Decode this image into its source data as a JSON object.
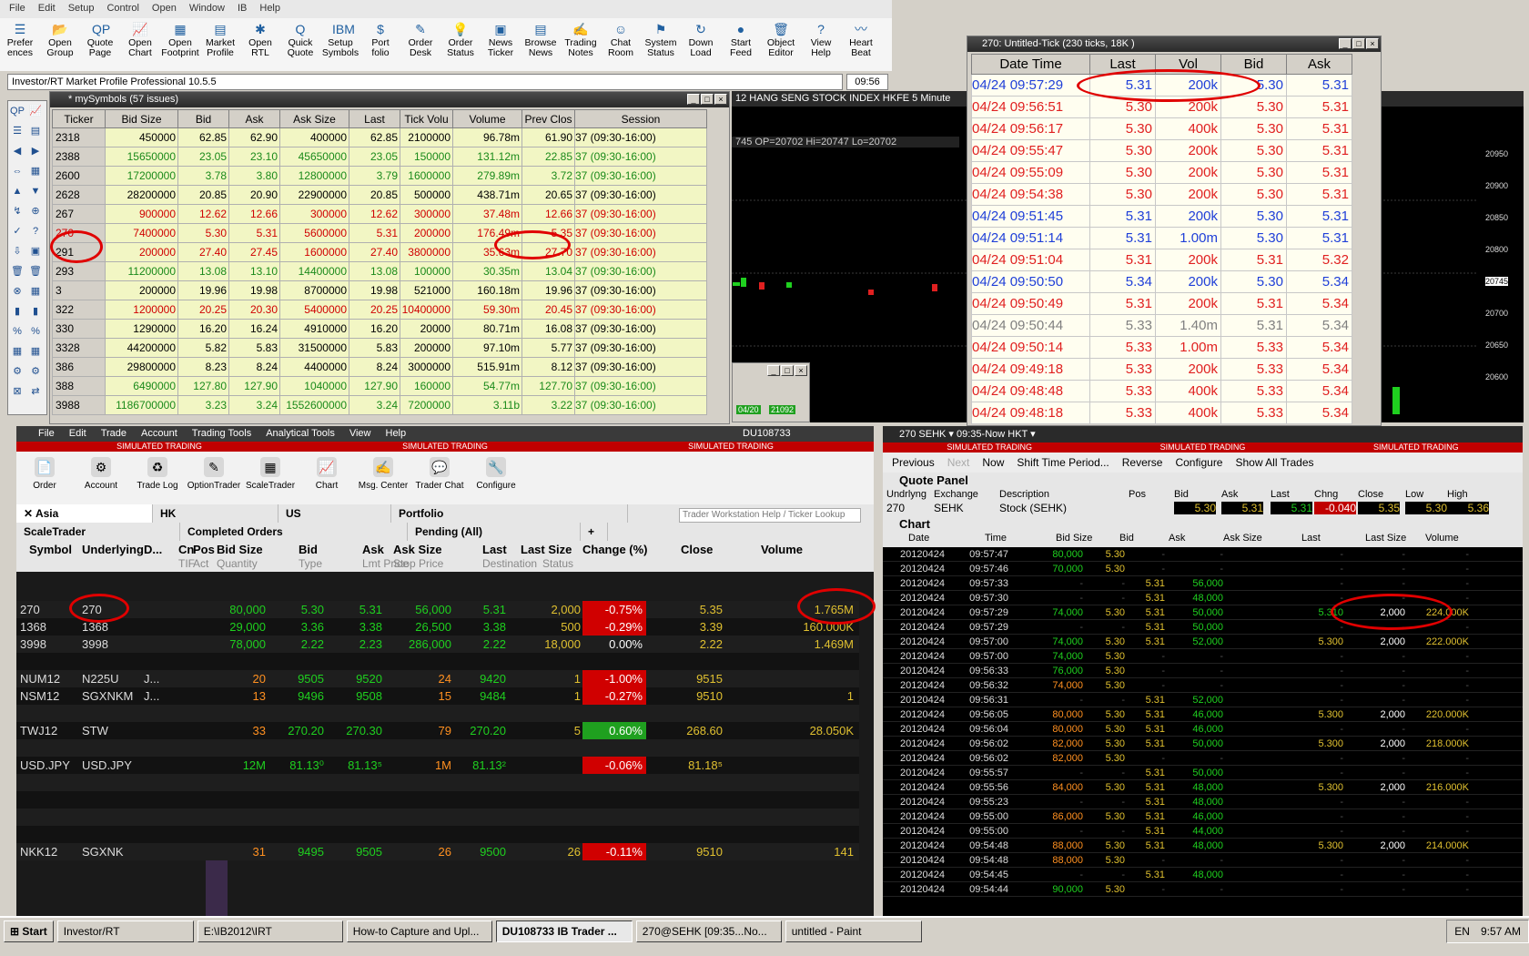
{
  "menubar": [
    "File",
    "Edit",
    "Setup",
    "Control",
    "Open",
    "Window",
    "IB",
    "Help"
  ],
  "toolbar": [
    {
      "l1": "Prefer",
      "l2": "ences",
      "icon": "☰"
    },
    {
      "l1": "Open",
      "l2": "Group",
      "icon": "📂"
    },
    {
      "l1": "Quote",
      "l2": "Page",
      "icon": "QP"
    },
    {
      "l1": "Open",
      "l2": "Chart",
      "icon": "📈"
    },
    {
      "l1": "Open",
      "l2": "Footprint",
      "icon": "▦"
    },
    {
      "l1": "Market",
      "l2": "Profile",
      "icon": "▤"
    },
    {
      "l1": "Open",
      "l2": "RTL",
      "icon": "✱"
    },
    {
      "l1": "Quick",
      "l2": "Quote",
      "icon": "Q"
    },
    {
      "l1": "Setup",
      "l2": "Symbols",
      "icon": "IBM"
    },
    {
      "l1": "Port",
      "l2": "folio",
      "icon": "$"
    },
    {
      "l1": "Order",
      "l2": "Desk",
      "icon": "✎"
    },
    {
      "l1": "Order",
      "l2": "Status",
      "icon": "💡"
    },
    {
      "l1": "News",
      "l2": "Ticker",
      "icon": "▣"
    },
    {
      "l1": "Browse",
      "l2": "News",
      "icon": "▤"
    },
    {
      "l1": "Trading",
      "l2": "Notes",
      "icon": "✍"
    },
    {
      "l1": "Chat",
      "l2": "Room",
      "icon": "☺"
    },
    {
      "l1": "System",
      "l2": "Status",
      "icon": "⚑"
    },
    {
      "l1": "Down",
      "l2": "Load",
      "icon": "↻"
    },
    {
      "l1": "Start",
      "l2": "Feed",
      "icon": "●"
    },
    {
      "l1": "Object",
      "l2": "Editor",
      "icon": "🗑"
    },
    {
      "l1": "View",
      "l2": "Help",
      "icon": "?"
    },
    {
      "l1": "Heart",
      "l2": "Beat",
      "icon": "〰"
    }
  ],
  "address": "Investor/RT Market Profile Professional 10.5.5",
  "clock": "09:56",
  "mysymbols": {
    "title": "* mySymbols (57 issues)",
    "headers": [
      "Ticker",
      "Bid Size",
      "Bid",
      "Ask",
      "Ask Size",
      "Last",
      "Tick Volu",
      "Volume",
      "Prev Clos",
      "Session"
    ],
    "rows": [
      [
        "2318",
        "450000",
        "62.85",
        "62.90",
        "400000",
        "62.85",
        "2100000",
        "96.78m",
        "61.90",
        "37 (09:30-16:00)"
      ],
      [
        "2388",
        "15650000",
        "23.05",
        "23.10",
        "45650000",
        "23.05",
        "150000",
        "131.12m",
        "22.85",
        "37 (09:30-16:00)"
      ],
      [
        "2600",
        "17200000",
        "3.78",
        "3.80",
        "12800000",
        "3.79",
        "1600000",
        "279.89m",
        "3.72",
        "37 (09:30-16:00)"
      ],
      [
        "2628",
        "28200000",
        "20.85",
        "20.90",
        "22900000",
        "20.85",
        "500000",
        "438.71m",
        "20.65",
        "37 (09:30-16:00)"
      ],
      [
        "267",
        "900000",
        "12.62",
        "12.66",
        "300000",
        "12.62",
        "300000",
        "37.48m",
        "12.66",
        "37 (09:30-16:00)"
      ],
      [
        "270",
        "7400000",
        "5.30",
        "5.31",
        "5600000",
        "5.31",
        "200000",
        "176.49m",
        "5.35",
        "37 (09:30-16:00)"
      ],
      [
        "291",
        "200000",
        "27.40",
        "27.45",
        "1600000",
        "27.40",
        "3800000",
        "35.63m",
        "27.70",
        "37 (09:30-16:00)"
      ],
      [
        "293",
        "11200000",
        "13.08",
        "13.10",
        "14400000",
        "13.08",
        "100000",
        "30.35m",
        "13.04",
        "37 (09:30-16:00)"
      ],
      [
        "3",
        "200000",
        "19.96",
        "19.98",
        "8700000",
        "19.98",
        "521000",
        "160.18m",
        "19.96",
        "37 (09:30-16:00)"
      ],
      [
        "322",
        "1200000",
        "20.25",
        "20.30",
        "5400000",
        "20.25",
        "10400000",
        "59.30m",
        "20.45",
        "37 (09:30-16:00)"
      ],
      [
        "330",
        "1290000",
        "16.20",
        "16.24",
        "4910000",
        "16.20",
        "20000",
        "80.71m",
        "16.08",
        "37 (09:30-16:00)"
      ],
      [
        "3328",
        "44200000",
        "5.82",
        "5.83",
        "31500000",
        "5.83",
        "200000",
        "97.10m",
        "5.77",
        "37 (09:30-16:00)"
      ],
      [
        "386",
        "29800000",
        "8.23",
        "8.24",
        "4400000",
        "8.24",
        "3000000",
        "515.91m",
        "8.12",
        "37 (09:30-16:00)"
      ],
      [
        "388",
        "6490000",
        "127.80",
        "127.90",
        "1040000",
        "127.90",
        "160000",
        "54.77m",
        "127.70",
        "37 (09:30-16:00)"
      ],
      [
        "3988",
        "1186700000",
        "3.23",
        "3.24",
        "1552600000",
        "3.24",
        "7200000",
        "3.11b",
        "3.22",
        "37 (09:30-16:00)"
      ]
    ]
  },
  "hangseng": {
    "title": "12 HANG SENG STOCK INDEX HKFE 5 Minute",
    "ohlc": "745 OP=20702 Hi=20747 Lo=20702",
    "price_labels": [
      "20950",
      "20900",
      "20850",
      "20800",
      "20745",
      "20700",
      "20650",
      "20600"
    ],
    "mini_date": "04/20",
    "mini_price": "21092"
  },
  "tick": {
    "title": "270: Untitled-Tick (230 ticks, 18K )",
    "headers": [
      "Date Time",
      "Last",
      "Vol",
      "Bid",
      "Ask"
    ],
    "rows": [
      {
        "c": [
          "04/24 09:57:29",
          "5.31",
          "200k",
          "5.30",
          "5.31"
        ],
        "col": "#1f3fd8"
      },
      {
        "c": [
          "04/24 09:56:51",
          "5.30",
          "200k",
          "5.30",
          "5.31"
        ],
        "col": "#e02020"
      },
      {
        "c": [
          "04/24 09:56:17",
          "5.30",
          "400k",
          "5.30",
          "5.31"
        ],
        "col": "#e02020"
      },
      {
        "c": [
          "04/24 09:55:47",
          "5.30",
          "200k",
          "5.30",
          "5.31"
        ],
        "col": "#e02020"
      },
      {
        "c": [
          "04/24 09:55:09",
          "5.30",
          "200k",
          "5.30",
          "5.31"
        ],
        "col": "#e02020"
      },
      {
        "c": [
          "04/24 09:54:38",
          "5.30",
          "200k",
          "5.30",
          "5.31"
        ],
        "col": "#e02020"
      },
      {
        "c": [
          "04/24 09:51:45",
          "5.31",
          "200k",
          "5.30",
          "5.31"
        ],
        "col": "#1f3fd8"
      },
      {
        "c": [
          "04/24 09:51:14",
          "5.31",
          "1.00m",
          "5.30",
          "5.31"
        ],
        "col": "#1f3fd8"
      },
      {
        "c": [
          "04/24 09:51:04",
          "5.31",
          "200k",
          "5.31",
          "5.32"
        ],
        "col": "#e02020"
      },
      {
        "c": [
          "04/24 09:50:50",
          "5.34",
          "200k",
          "5.30",
          "5.34"
        ],
        "col": "#1f3fd8"
      },
      {
        "c": [
          "04/24 09:50:49",
          "5.31",
          "200k",
          "5.31",
          "5.34"
        ],
        "col": "#e02020"
      },
      {
        "c": [
          "04/24 09:50:44",
          "5.33",
          "1.40m",
          "5.31",
          "5.34"
        ],
        "col": "#808080"
      },
      {
        "c": [
          "04/24 09:50:14",
          "5.33",
          "1.00m",
          "5.33",
          "5.34"
        ],
        "col": "#e02020"
      },
      {
        "c": [
          "04/24 09:49:18",
          "5.33",
          "200k",
          "5.33",
          "5.34"
        ],
        "col": "#e02020"
      },
      {
        "c": [
          "04/24 09:48:48",
          "5.33",
          "400k",
          "5.33",
          "5.34"
        ],
        "col": "#e02020"
      },
      {
        "c": [
          "04/24 09:48:18",
          "5.33",
          "400k",
          "5.33",
          "5.34"
        ],
        "col": "#e02020"
      }
    ]
  },
  "tws": {
    "account": "DU108733",
    "menu": [
      "File",
      "Edit",
      "Trade",
      "Account",
      "Trading Tools",
      "Analytical Tools",
      "View",
      "Help"
    ],
    "sim": "SIMULATED TRADING",
    "tools": [
      "Order",
      "Account",
      "Trade Log",
      "OptionTrader",
      "ScaleTrader",
      "Chart",
      "Msg. Center",
      "Trader Chat",
      "Configure"
    ],
    "tabs": [
      "Asia",
      "HK",
      "US",
      "Portfolio"
    ],
    "search_placeholder": "Trader Workstation Help / Ticker Lookup",
    "subtabs": [
      "ScaleTrader",
      "Completed Orders",
      "Pending (All)",
      "+"
    ],
    "headers": {
      "symbol": "Symbol",
      "underlying": "Underlying",
      "d": "D...",
      "cn": "Cn",
      "pos": "Pos",
      "bidsize": "Bid Size",
      "bid": "Bid",
      "ask": "Ask",
      "asksize": "Ask Size",
      "last": "Last",
      "lastsize": "Last Size",
      "change": "Change (%)",
      "close": "Close",
      "volume": "Volume"
    },
    "subheaders": {
      "tif": "TIF",
      "act": "Act",
      "qty": "Quantity",
      "type": "Type",
      "lmt": "Lmt Price",
      "stop": "Stop Price",
      "dest": "Destination",
      "status": "Status"
    },
    "rows": [
      {
        "sym": "270",
        "und": "270",
        "bs": "80,000",
        "bid": "5.30",
        "ask": "5.31",
        "as": "56,000",
        "last": "5.31",
        "ls": "2,000",
        "chg": "-0.75%",
        "chgc": "#d00000",
        "close": "5.35",
        "vol": "1.765M"
      },
      {
        "sym": "1368",
        "und": "1368",
        "bs": "29,000",
        "bid": "3.36",
        "ask": "3.38",
        "as": "26,500",
        "last": "3.38",
        "ls": "500",
        "chg": "-0.29%",
        "chgc": "#d00000",
        "close": "3.39",
        "vol": "160.000K"
      },
      {
        "sym": "3998",
        "und": "3998",
        "bs": "78,000",
        "bid": "2.22",
        "ask": "2.23",
        "as": "286,000",
        "last": "2.22",
        "ls": "18,000",
        "chg": "0.00%",
        "chgc": "",
        "close": "2.22",
        "vol": "1.469M"
      },
      {
        "sym": "",
        "und": "",
        "bs": "",
        "bid": "",
        "ask": "",
        "as": "",
        "last": "",
        "ls": "",
        "chg": "",
        "chgc": "",
        "close": "",
        "vol": ""
      },
      {
        "sym": "NUM12",
        "und": "N225U",
        "d": "J...",
        "bs": "20",
        "bid": "9505",
        "ask": "9520",
        "as": "24",
        "last": "9420",
        "ls": "1",
        "chg": "-1.00%",
        "chgc": "#d00000",
        "close": "9515",
        "vol": ""
      },
      {
        "sym": "NSM12",
        "und": "SGXNKM",
        "d": "J...",
        "bs": "13",
        "bid": "9496",
        "ask": "9508",
        "as": "15",
        "last": "9484",
        "ls": "1",
        "chg": "-0.27%",
        "chgc": "#d00000",
        "close": "9510",
        "vol": "1"
      },
      {
        "sym": "",
        "und": "",
        "bs": "",
        "bid": "",
        "ask": "",
        "as": "",
        "last": "",
        "ls": "",
        "chg": "",
        "chgc": "",
        "close": "",
        "vol": ""
      },
      {
        "sym": "TWJ12",
        "und": "STW",
        "bs": "33",
        "bid": "270.20",
        "ask": "270.30",
        "as": "79",
        "last": "270.20",
        "ls": "5",
        "chg": "0.60%",
        "chgc": "#1fa01f",
        "close": "268.60",
        "vol": "28.050K"
      },
      {
        "sym": "",
        "und": "",
        "bs": "",
        "bid": "",
        "ask": "",
        "as": "",
        "last": "",
        "ls": "",
        "chg": "",
        "chgc": "",
        "close": "",
        "vol": ""
      },
      {
        "sym": "USD.JPY",
        "und": "USD.JPY",
        "bs": "12M",
        "bid": "81.13⁰",
        "ask": "81.13⁵",
        "as": "1M",
        "last": "81.13²",
        "ls": "",
        "chg": "-0.06%",
        "chgc": "#d00000",
        "close": "81.18⁵",
        "vol": ""
      },
      {
        "sym": "",
        "und": "",
        "bs": "",
        "bid": "",
        "ask": "",
        "as": "",
        "last": "",
        "ls": "",
        "chg": "",
        "chgc": "",
        "close": "",
        "vol": ""
      },
      {
        "sym": "",
        "und": "",
        "bs": "",
        "bid": "",
        "ask": "",
        "as": "",
        "last": "",
        "ls": "",
        "chg": "",
        "chgc": "",
        "close": "",
        "vol": ""
      },
      {
        "sym": "",
        "und": "",
        "bs": "",
        "bid": "",
        "ask": "",
        "as": "",
        "last": "",
        "ls": "",
        "chg": "",
        "chgc": "",
        "close": "",
        "vol": ""
      },
      {
        "sym": "",
        "und": "",
        "bs": "",
        "bid": "",
        "ask": "",
        "as": "",
        "last": "",
        "ls": "",
        "chg": "",
        "chgc": "",
        "close": "",
        "vol": ""
      },
      {
        "sym": "NKK12",
        "und": "SGXNK",
        "bs": "31",
        "bid": "9495",
        "ask": "9505",
        "as": "26",
        "last": "9500",
        "ls": "26",
        "chg": "-0.11%",
        "chgc": "#d00000",
        "close": "9510",
        "vol": "141"
      }
    ]
  },
  "sehk": {
    "title": "270 SEHK ▾   09:35-Now HKT ▾",
    "sim": "SIMULATED TRADING",
    "nav": [
      "Previous",
      "Next",
      "Now",
      "Shift Time Period...",
      "Reverse",
      "Configure",
      "Show All Trades"
    ],
    "quote_panel": "Quote Panel",
    "qheaders": [
      "Undrlyng",
      "Exchange",
      "Description",
      "Pos",
      "Bid",
      "Ask",
      "Last",
      "Chng",
      "Close",
      "Low",
      "High"
    ],
    "qrow": [
      "270",
      "SEHK",
      "Stock (SEHK)",
      "",
      "5.30",
      "5.31",
      "5.31",
      "-0.040",
      "5.35",
      "5.30",
      "5.36"
    ],
    "chart_label": "Chart",
    "theaders": [
      "Date",
      "Time",
      "Bid Size",
      "Bid",
      "Ask",
      "Ask Size",
      "Last",
      "Last Size",
      "Volume"
    ],
    "rows": [
      [
        "20120424",
        "09:57:47",
        "80,000",
        "5.30",
        "-",
        "-",
        "-",
        "-",
        "-"
      ],
      [
        "20120424",
        "09:57:46",
        "70,000",
        "5.30",
        "-",
        "-",
        "-",
        "-",
        "-"
      ],
      [
        "20120424",
        "09:57:33",
        "-",
        "-",
        "5.31",
        "56,000",
        "-",
        "-",
        "-"
      ],
      [
        "20120424",
        "09:57:30",
        "-",
        "-",
        "5.31",
        "48,000",
        "-",
        "-",
        "-"
      ],
      [
        "20120424",
        "09:57:29",
        "74,000",
        "5.30",
        "5.31",
        "50,000",
        "5.310",
        "2,000",
        "224.000K"
      ],
      [
        "20120424",
        "09:57:29",
        "-",
        "-",
        "5.31",
        "50,000",
        "-",
        "-",
        "-"
      ],
      [
        "20120424",
        "09:57:00",
        "74,000",
        "5.30",
        "5.31",
        "52,000",
        "5.300",
        "2,000",
        "222.000K"
      ],
      [
        "20120424",
        "09:57:00",
        "74,000",
        "5.30",
        "-",
        "-",
        "-",
        "-",
        "-"
      ],
      [
        "20120424",
        "09:56:33",
        "76,000",
        "5.30",
        "-",
        "-",
        "-",
        "-",
        "-"
      ],
      [
        "20120424",
        "09:56:32",
        "74,000",
        "5.30",
        "-",
        "-",
        "-",
        "-",
        "-"
      ],
      [
        "20120424",
        "09:56:31",
        "-",
        "-",
        "5.31",
        "52,000",
        "-",
        "-",
        "-"
      ],
      [
        "20120424",
        "09:56:05",
        "80,000",
        "5.30",
        "5.31",
        "46,000",
        "5.300",
        "2,000",
        "220.000K"
      ],
      [
        "20120424",
        "09:56:04",
        "80,000",
        "5.30",
        "5.31",
        "46,000",
        "-",
        "-",
        "-"
      ],
      [
        "20120424",
        "09:56:02",
        "82,000",
        "5.30",
        "5.31",
        "50,000",
        "5.300",
        "2,000",
        "218.000K"
      ],
      [
        "20120424",
        "09:56:02",
        "82,000",
        "5.30",
        "-",
        "-",
        "-",
        "-",
        "-"
      ],
      [
        "20120424",
        "09:55:57",
        "-",
        "-",
        "5.31",
        "50,000",
        "-",
        "-",
        "-"
      ],
      [
        "20120424",
        "09:55:56",
        "84,000",
        "5.30",
        "5.31",
        "48,000",
        "5.300",
        "2,000",
        "216.000K"
      ],
      [
        "20120424",
        "09:55:23",
        "-",
        "-",
        "5.31",
        "48,000",
        "-",
        "-",
        "-"
      ],
      [
        "20120424",
        "09:55:00",
        "86,000",
        "5.30",
        "5.31",
        "46,000",
        "-",
        "-",
        "-"
      ],
      [
        "20120424",
        "09:55:00",
        "-",
        "-",
        "5.31",
        "44,000",
        "-",
        "-",
        "-"
      ],
      [
        "20120424",
        "09:54:48",
        "88,000",
        "5.30",
        "5.31",
        "48,000",
        "5.300",
        "2,000",
        "214.000K"
      ],
      [
        "20120424",
        "09:54:48",
        "88,000",
        "5.30",
        "-",
        "-",
        "-",
        "-",
        "-"
      ],
      [
        "20120424",
        "09:54:45",
        "-",
        "-",
        "5.31",
        "48,000",
        "-",
        "-",
        "-"
      ],
      [
        "20120424",
        "09:54:44",
        "90,000",
        "5.30",
        "-",
        "-",
        "-",
        "-",
        "-"
      ]
    ]
  },
  "taskbar": {
    "start": "Start",
    "items": [
      "Investor/RT",
      "E:\\IB2012\\IRT",
      "How-to Capture and Upl...",
      "DU108733 IB Trader ...",
      "270@SEHK [09:35...No...",
      "untitled - Paint"
    ],
    "lang": "EN",
    "time": "9:57 AM"
  }
}
